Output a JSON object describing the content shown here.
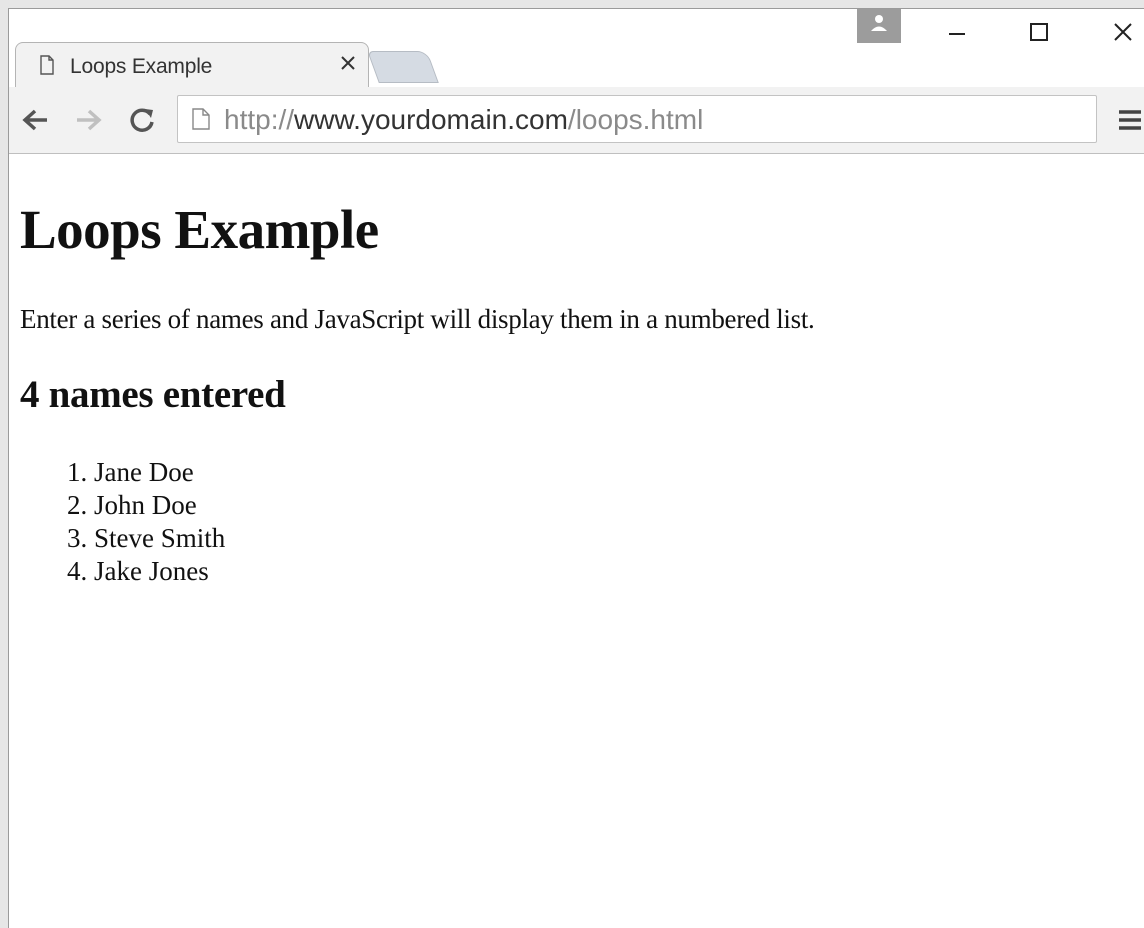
{
  "browser": {
    "tab": {
      "title": "Loops Example",
      "favicon": "page-icon",
      "close": "close-icon"
    },
    "window_controls": [
      "minimize-icon",
      "maximize-icon",
      "close-icon"
    ],
    "profile_icon": "person-icon",
    "toolbar": {
      "back": "back-arrow-icon",
      "forward": "forward-arrow-icon",
      "reload": "reload-icon",
      "menu": "hamburger-menu-icon"
    },
    "address": {
      "scheme": "http://",
      "host": "www.yourdomain.com",
      "path": "/loops.html"
    }
  },
  "page": {
    "heading": "Loops Example",
    "description": "Enter a series of names and JavaScript will display them in a numbered list.",
    "count_heading": "4 names entered",
    "names": [
      "Jane Doe",
      "John Doe",
      "Steve Smith",
      "Jake Jones"
    ]
  },
  "colors": {
    "chrome_bg": "#f2f2f2",
    "content_bg": "#ffffff",
    "profile_badge": "#9c9c9c"
  }
}
